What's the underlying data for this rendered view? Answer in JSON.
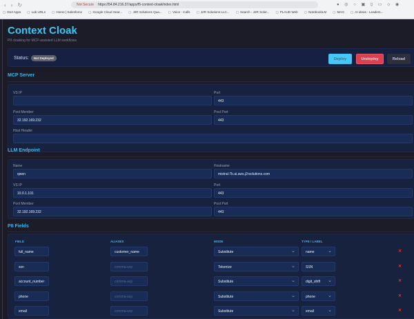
{
  "browser": {
    "security": "Not Secure",
    "url": "https://54.84.216.37/apps/f5-context-cloak/index.html",
    "bookmarks": [
      "Do3 Apps",
      "Lab URLs",
      "Home | Salesforce",
      "Google Cloud Sear...",
      "J2R Solutions Qua...",
      "Voice - Calls",
      "J2R Solutions LLC...",
      "Search - J2R Solut...",
      "PLAUD Web",
      "NotebookLM",
      "MAG",
      "AI ideas - Leaders..."
    ]
  },
  "header": {
    "title": "Context Cloak",
    "subtitle": "PII cloaking for MCP-assisted LLM workflows"
  },
  "status": {
    "label": "Status:",
    "value": "Not Deployed",
    "deploy": "Deploy",
    "undeploy": "Undeploy",
    "reload": "Reload"
  },
  "mcp": {
    "title": "MCP Server",
    "vs_ip_label": "VS IP",
    "vs_ip": "",
    "port_label": "Port",
    "port": "443",
    "pool_member_label": "Pool Member",
    "pool_member": "32.192.169.232",
    "pool_port_label": "Pool Port",
    "pool_port": "443",
    "host_header_label": "Host Header",
    "host_header": ""
  },
  "llm": {
    "title": "LLM Endpoint",
    "name_label": "Name",
    "name": "qwen",
    "hostname_label": "Hostname",
    "hostname": "mistral-7b.ai.aws.j2rsolutions.com",
    "vs_ip_label": "VS IP",
    "vs_ip": "10.0.1.101",
    "port_label": "Port",
    "port": "443",
    "pool_member_label": "Pool Member",
    "pool_member": "32.192.169.232",
    "pool_port_label": "Pool Port",
    "pool_port": "443"
  },
  "pii": {
    "title": "PII Fields",
    "headers": {
      "field": "FIELD",
      "aliases": "ALIASES",
      "mode": "MODE",
      "type": "TYPE / LABEL"
    },
    "placeholder": "comma-sep",
    "delete": "✕",
    "rows": [
      {
        "field": "full_name",
        "aliases": "customer_name",
        "mode": "Substitute",
        "type": "name"
      },
      {
        "field": "ssn",
        "aliases": "",
        "mode": "Tokenize",
        "type": "SSN"
      },
      {
        "field": "account_number",
        "aliases": "",
        "mode": "Substitute",
        "type": "digit_shift"
      },
      {
        "field": "phone",
        "aliases": "",
        "mode": "Substitute",
        "type": "phone"
      },
      {
        "field": "email",
        "aliases": "",
        "mode": "Substitute",
        "type": "email"
      }
    ]
  }
}
